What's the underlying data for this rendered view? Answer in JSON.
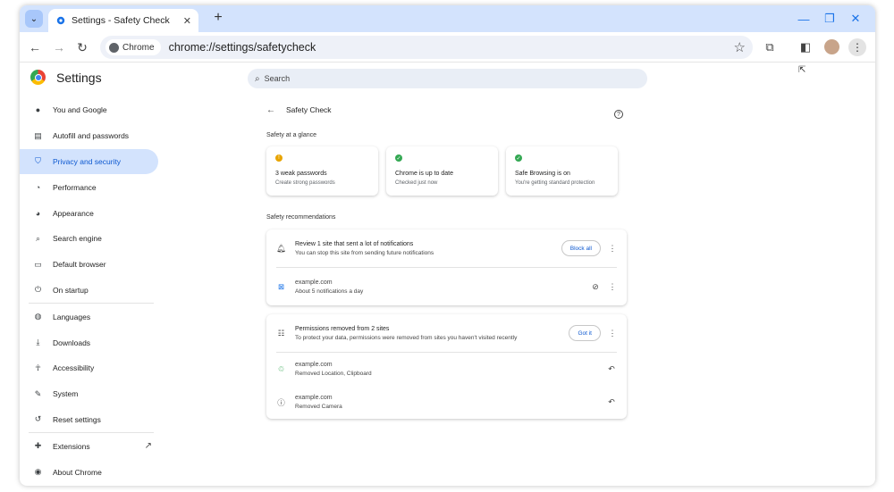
{
  "window": {
    "tab_title": "Settings - Safety Check",
    "url": "chrome://settings/safetycheck",
    "site_chip": "Chrome"
  },
  "settings": {
    "title": "Settings",
    "search_placeholder": "Search"
  },
  "sidebar": {
    "items": [
      {
        "label": "You and Google",
        "icon": "person-icon"
      },
      {
        "label": "Autofill and passwords",
        "icon": "clipboard-icon"
      },
      {
        "label": "Privacy and security",
        "icon": "shield-icon"
      },
      {
        "label": "Performance",
        "icon": "speedometer-icon"
      },
      {
        "label": "Appearance",
        "icon": "palette-icon"
      },
      {
        "label": "Search engine",
        "icon": "search-icon"
      },
      {
        "label": "Default browser",
        "icon": "browser-icon"
      },
      {
        "label": "On startup",
        "icon": "power-icon"
      },
      {
        "label": "Languages",
        "icon": "globe-icon"
      },
      {
        "label": "Downloads",
        "icon": "download-icon"
      },
      {
        "label": "Accessibility",
        "icon": "accessibility-icon"
      },
      {
        "label": "System",
        "icon": "wrench-icon"
      },
      {
        "label": "Reset settings",
        "icon": "history-icon"
      },
      {
        "label": "Extensions",
        "icon": "puzzle-icon"
      },
      {
        "label": "About Chrome",
        "icon": "chrome-icon"
      }
    ],
    "active_index": 2
  },
  "safety_check": {
    "title": "Safety Check",
    "glance_label": "Safety at a glance",
    "cards": [
      {
        "title": "3 weak passwords",
        "subtitle": "Create strong passwords",
        "status_color": "#e8a400"
      },
      {
        "title": "Chrome is up to date",
        "subtitle": "Checked just now",
        "status_color": "#34a853"
      },
      {
        "title": "Safe Browsing is on",
        "subtitle": "You're getting standard protection",
        "status_color": "#34a853"
      }
    ],
    "recommendations_label": "Safety recommendations",
    "notifications_panel": {
      "title": "Review 1 site that sent a lot of notifications",
      "subtitle": "You can stop this site from sending future notifications",
      "action": "Block all",
      "site": {
        "domain": "example.com",
        "detail": "About 5 notifications a day"
      }
    },
    "permissions_panel": {
      "title": "Permissions removed from 2 sites",
      "subtitle": "To protect your data, permissions were removed from sites you haven't visited recently",
      "action": "Got it",
      "sites": [
        {
          "domain": "example.com",
          "detail": "Removed Location, Clipboard"
        },
        {
          "domain": "example.com",
          "detail": "Removed Camera"
        }
      ]
    }
  }
}
